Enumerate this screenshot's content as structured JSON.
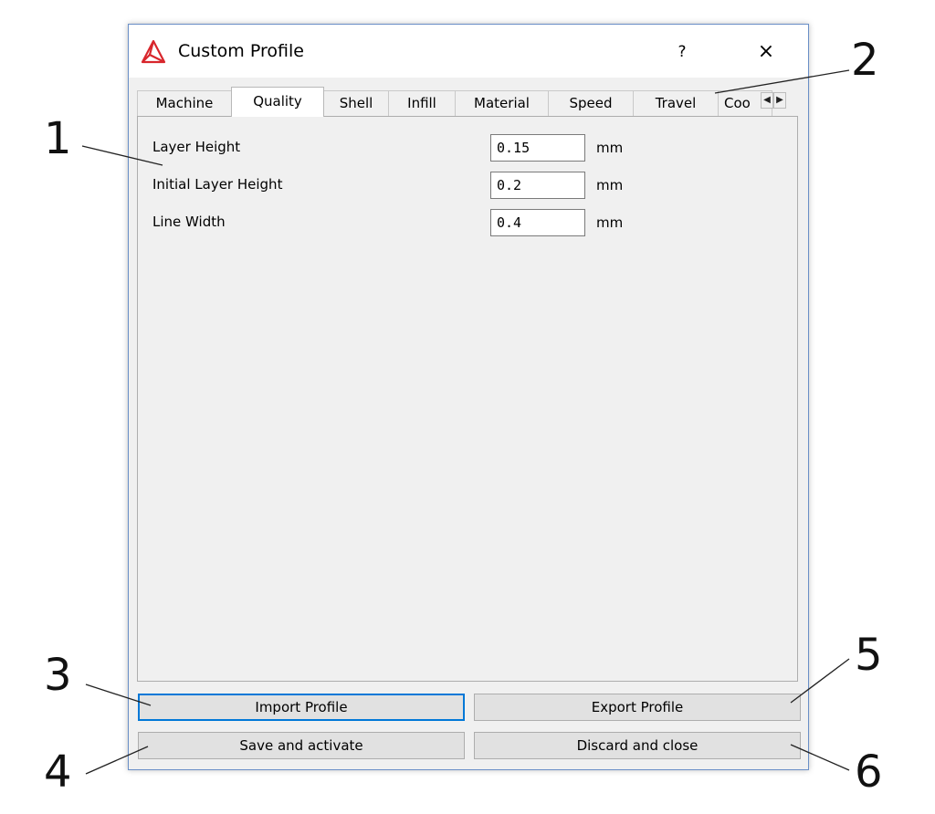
{
  "window": {
    "title": "Custom Profile",
    "help_glyph": "?",
    "close_glyph": "×"
  },
  "tabs": [
    {
      "label": "Machine",
      "active": false
    },
    {
      "label": "Quality",
      "active": true
    },
    {
      "label": "Shell",
      "active": false
    },
    {
      "label": "Infill",
      "active": false
    },
    {
      "label": "Material",
      "active": false
    },
    {
      "label": "Speed",
      "active": false
    },
    {
      "label": "Travel",
      "active": false
    },
    {
      "label": "Coo",
      "active": false
    }
  ],
  "tab_scroll": {
    "left_glyph": "◀",
    "right_glyph": "▶"
  },
  "fields": [
    {
      "label": "Layer Height",
      "value": "0.15",
      "unit": "mm"
    },
    {
      "label": "Initial Layer Height",
      "value": "0.2",
      "unit": "mm"
    },
    {
      "label": "Line Width",
      "value": "0.4",
      "unit": "mm"
    }
  ],
  "buttons": {
    "import": "Import Profile",
    "export": "Export Profile",
    "save": "Save and activate",
    "discard": "Discard and close"
  },
  "callouts": [
    "1",
    "2",
    "3",
    "4",
    "5",
    "6"
  ],
  "colors": {
    "accent": "#0078d7",
    "app_icon": "#d8262c"
  }
}
